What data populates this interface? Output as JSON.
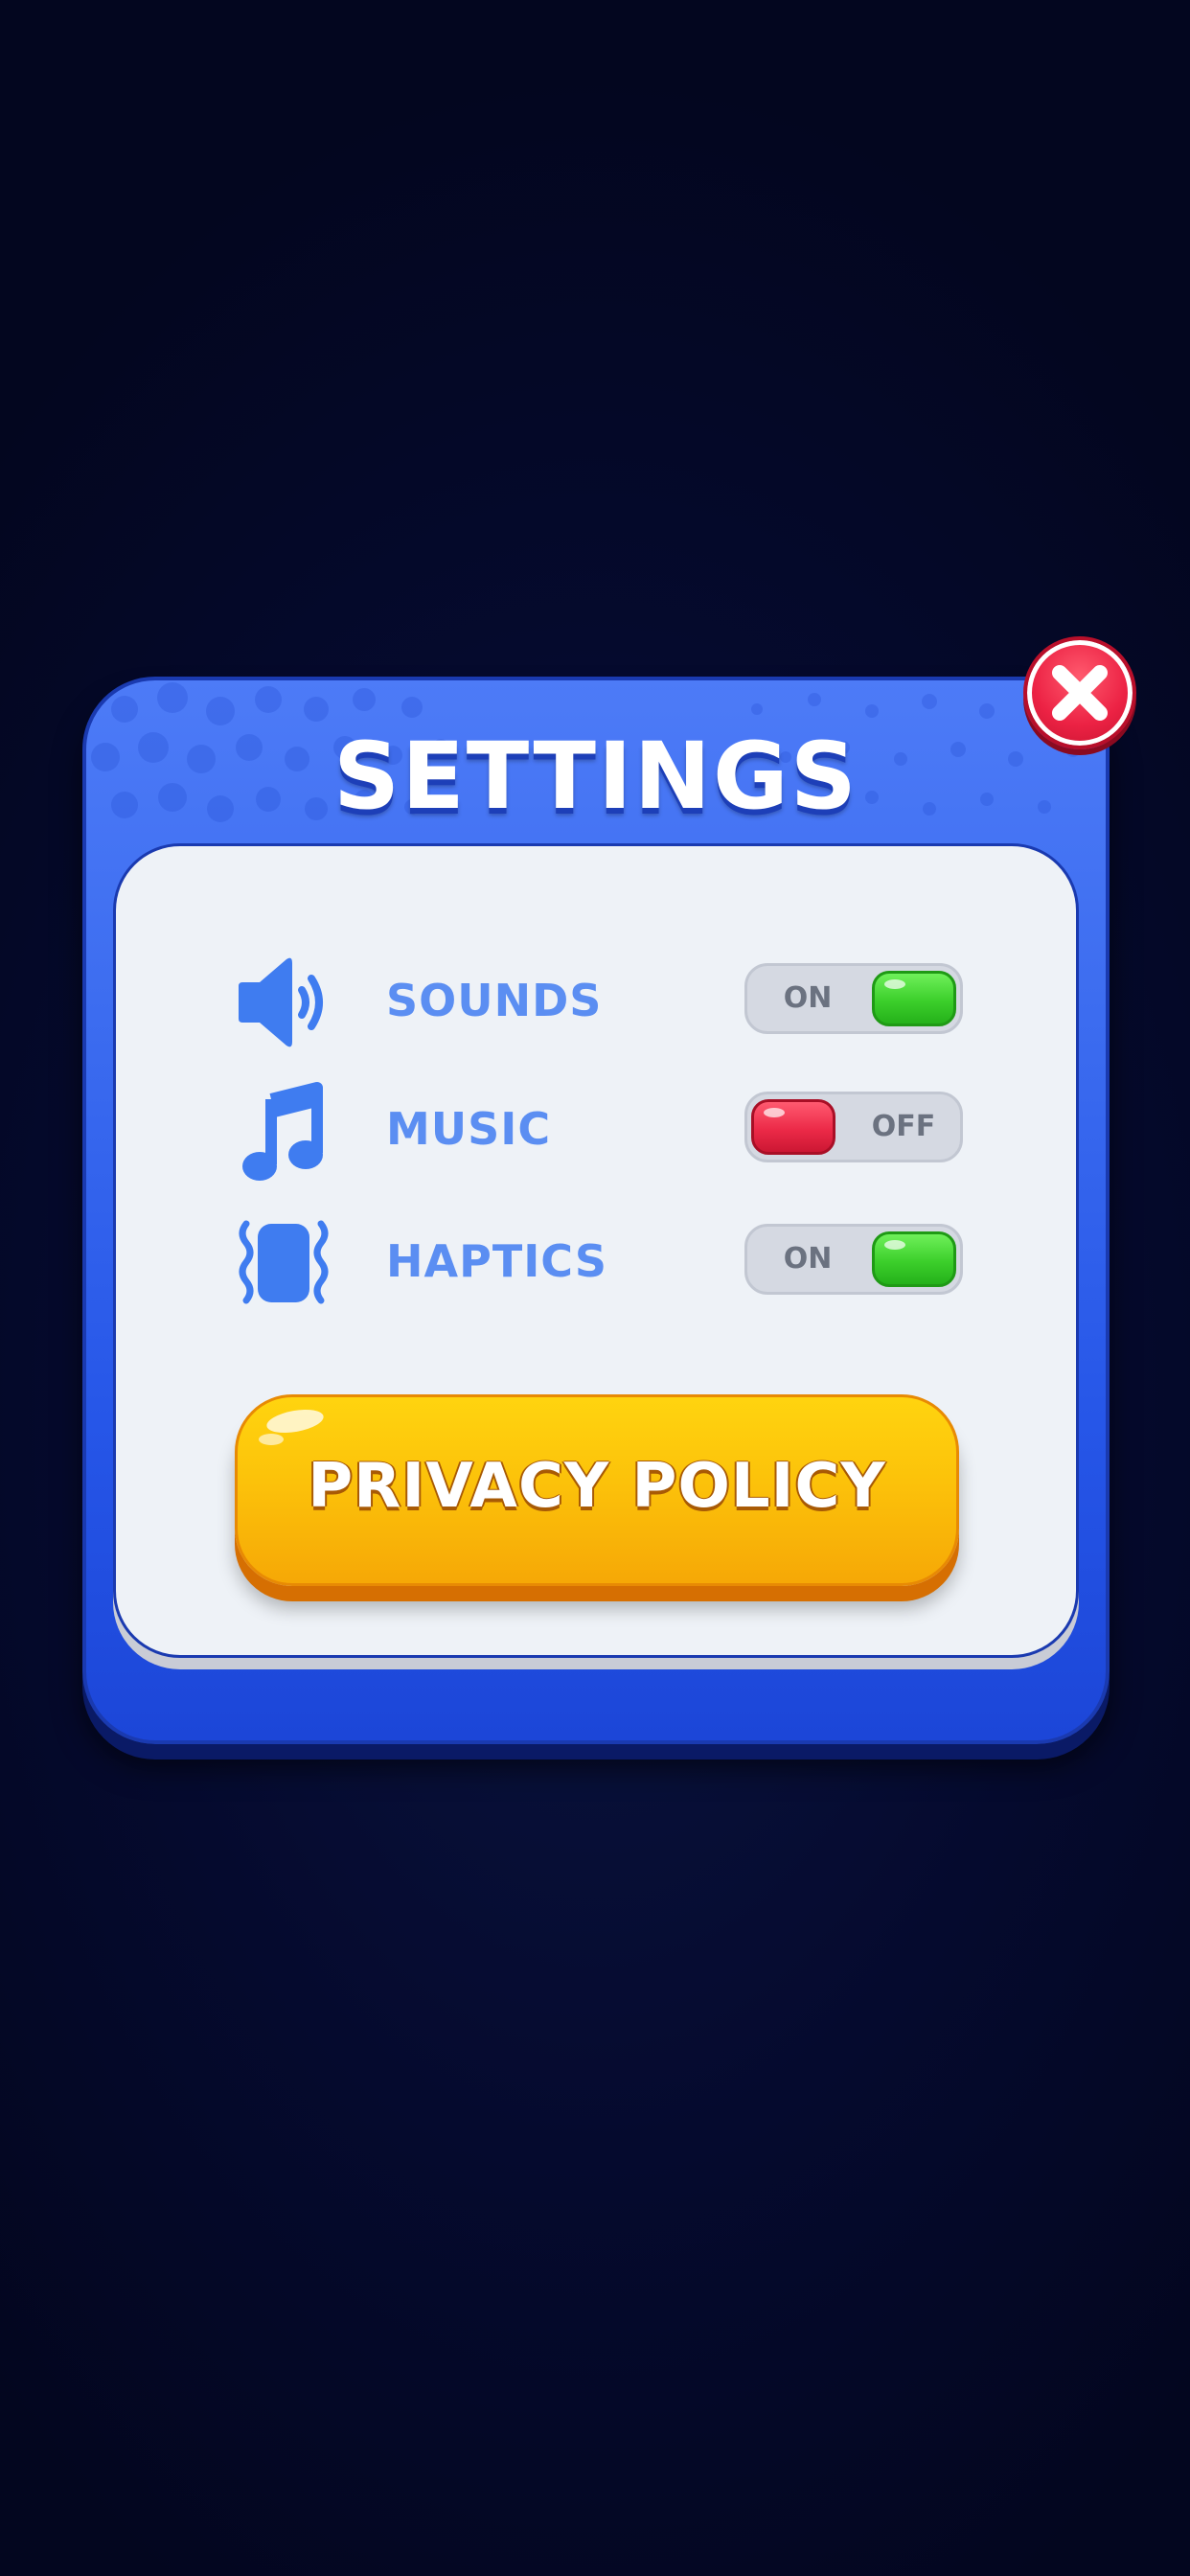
{
  "dialog": {
    "title": "SETTINGS",
    "close_icon": "close-icon"
  },
  "settings": [
    {
      "label": "SOUNDS",
      "icon": "speaker-icon",
      "state": "ON"
    },
    {
      "label": "MUSIC",
      "icon": "music-note-icon",
      "state": "OFF"
    },
    {
      "label": "HAPTICS",
      "icon": "vibration-icon",
      "state": "ON"
    }
  ],
  "privacy_button": {
    "label": "PRIVACY POLICY"
  },
  "colors": {
    "modal_blue": "#3d6df0",
    "panel": "#eef2f7",
    "label_blue": "#5b8ef2",
    "toggle_on": "#3ccf2b",
    "toggle_off": "#ec2a48",
    "button_yellow": "#fcc20a",
    "close_red": "#ec2244"
  }
}
